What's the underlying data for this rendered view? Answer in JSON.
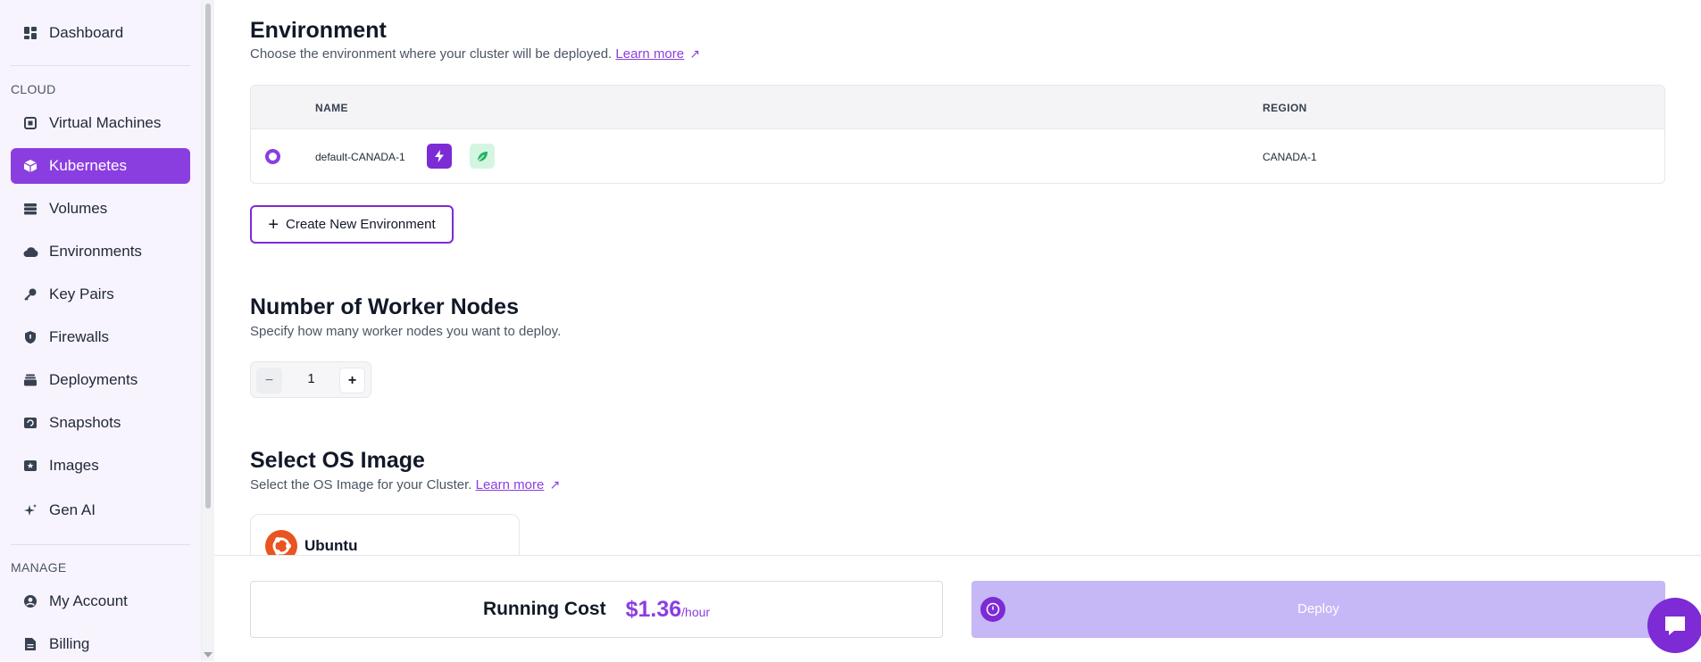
{
  "sidebar": {
    "top_item": {
      "label": "Dashboard",
      "icon": "dashboard-icon"
    },
    "cloud_label": "CLOUD",
    "cloud_items": [
      {
        "label": "Virtual Machines",
        "icon": "cpu-icon"
      },
      {
        "label": "Kubernetes",
        "icon": "cube-icon",
        "active": true
      },
      {
        "label": "Volumes",
        "icon": "database-icon"
      },
      {
        "label": "Environments",
        "icon": "cloud-icon"
      },
      {
        "label": "Key Pairs",
        "icon": "key-icon"
      },
      {
        "label": "Firewalls",
        "icon": "shield-icon"
      },
      {
        "label": "Deployments",
        "icon": "stack-icon"
      },
      {
        "label": "Snapshots",
        "icon": "snapshot-icon"
      },
      {
        "label": "Images",
        "icon": "image-icon"
      },
      {
        "label": "Gen AI",
        "icon": "sparkle-icon"
      }
    ],
    "manage_label": "MANAGE",
    "manage_items": [
      {
        "label": "My Account",
        "icon": "user-circle-icon"
      },
      {
        "label": "Billing",
        "icon": "document-icon"
      }
    ]
  },
  "environment": {
    "title": "Environment",
    "description": "Choose the environment where your cluster will be deployed.",
    "learn_more": "Learn more",
    "columns": {
      "name": "NAME",
      "region": "REGION"
    },
    "rows": [
      {
        "name": "default-CANADA-1",
        "region": "CANADA-1",
        "selected": true,
        "badges": [
          "lightning-icon",
          "leaf-icon"
        ]
      }
    ],
    "create_button": "Create New Environment"
  },
  "workers": {
    "title": "Number of Worker Nodes",
    "description": "Specify how many worker nodes you want to deploy.",
    "count": "1",
    "minus": "−",
    "plus": "+"
  },
  "os_image": {
    "title": "Select OS Image",
    "description": "Select the OS Image for your Cluster.",
    "learn_more": "Learn more",
    "options": [
      {
        "label": "Ubuntu",
        "icon": "ubuntu-icon"
      }
    ]
  },
  "footer": {
    "cost_label": "Running Cost",
    "cost_value": "$1.36",
    "cost_unit": "/hour",
    "deploy_label": "Deploy"
  },
  "colors": {
    "accent": "#8b3ee0",
    "deploy_disabled": "#c6b7f6",
    "ubuntu": "#e95420",
    "leaf_bg": "#d5f5e3"
  }
}
